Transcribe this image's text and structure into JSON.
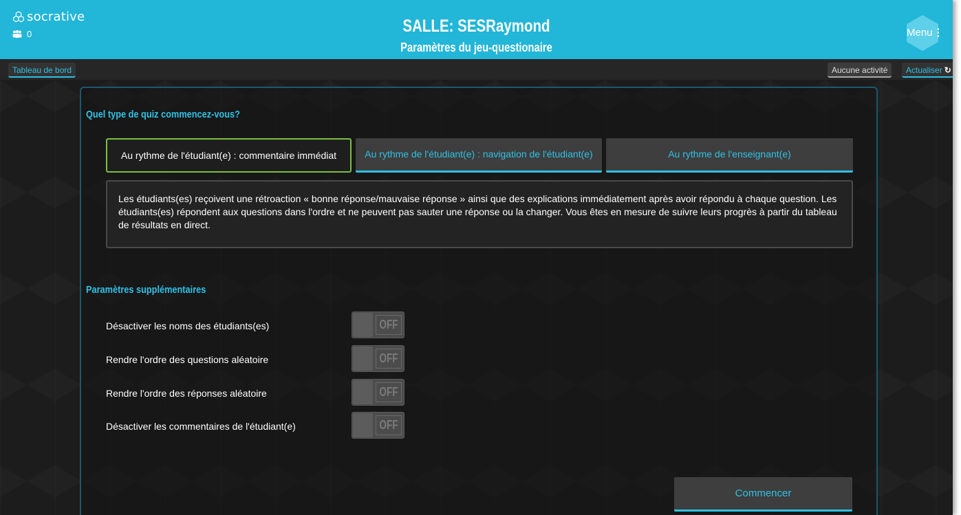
{
  "header": {
    "logo_text": "socrative",
    "user_count": "0",
    "room_title": "SALLE: SESRaymond",
    "room_subtitle": "Paramètres du jeu-questionaire",
    "menu_label": "Menu",
    "menu_dots": "⋮"
  },
  "toolbar": {
    "dashboard_label": "Tableau de bord",
    "no_activity_label": "Aucune activité",
    "refresh_label": "Actualiser",
    "refresh_icon": "↻"
  },
  "quiz_type": {
    "title": "Quel type de quiz commencez-vous?",
    "options": [
      {
        "label": "Au rythme de l'étudiant(e) : commentaire immédiat",
        "selected": true
      },
      {
        "label": "Au rythme de l'étudiant(e) : navigation de l'étudiant(e)",
        "selected": false
      },
      {
        "label": "Au rythme de l'enseignant(e)",
        "selected": false
      }
    ],
    "description": "Les étudiants(es) reçoivent une rétroaction « bonne réponse/mauvaise réponse » ainsi que des explications immédiatement après avoir répondu à chaque question. Les étudiants(es) répondent aux questions dans l'ordre et ne peuvent pas sauter une réponse ou la changer. Vous êtes en mesure de suivre leurs progrès à partir du tableau de résultats en direct."
  },
  "extra_settings": {
    "title": "Paramètres supplémentaires",
    "items": [
      {
        "label": "Désactiver les noms des étudiants(es)",
        "state": "OFF"
      },
      {
        "label": "Rendre l'ordre des questions aléatoire",
        "state": "OFF"
      },
      {
        "label": "Rendre l'ordre des réponses aléatoire",
        "state": "OFF"
      },
      {
        "label": "Désactiver les commentaires de l'étudiant(e)",
        "state": "OFF"
      }
    ]
  },
  "actions": {
    "start_label": "Commencer"
  },
  "colors": {
    "brand": "#22b6d8",
    "accent": "#2fc1e4",
    "selected_border": "#7bbf44",
    "background": "#1c1c1c"
  }
}
